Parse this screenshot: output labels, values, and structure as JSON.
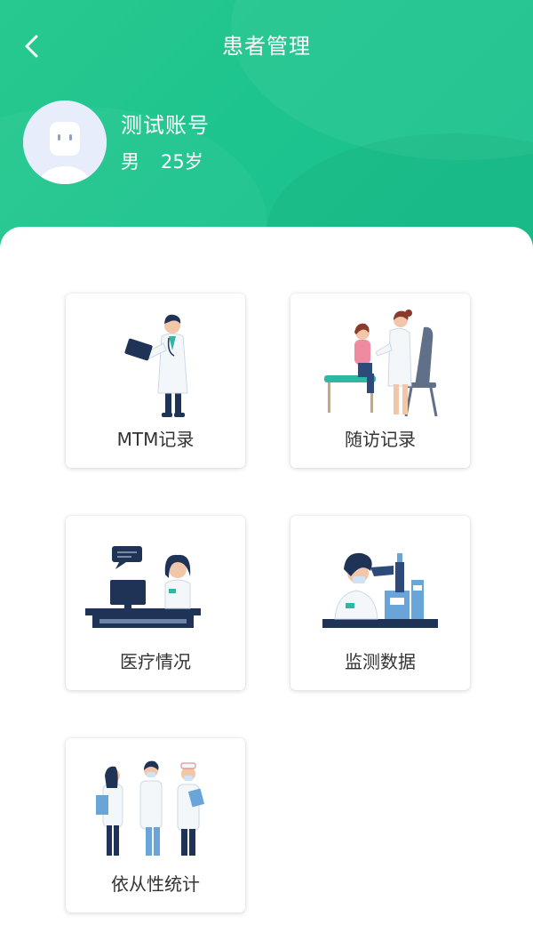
{
  "header": {
    "title": "患者管理",
    "back_icon": "chevron-left-icon"
  },
  "patient": {
    "name": "测试账号",
    "gender": "男",
    "age": "25岁",
    "avatar_icon": "user-avatar-icon"
  },
  "menu": [
    {
      "label": "MTM记录",
      "icon": "doctor-tablet-illustration"
    },
    {
      "label": "随访记录",
      "icon": "doctor-patient-visit-illustration"
    },
    {
      "label": "医疗情况",
      "icon": "doctor-computer-illustration"
    },
    {
      "label": "监测数据",
      "icon": "microscope-lab-illustration"
    },
    {
      "label": "依从性统计",
      "icon": "medical-team-illustration"
    }
  ],
  "colors": {
    "header_green": "#1ec48e",
    "navy": "#1e3356",
    "teal": "#2fb7a6",
    "text": "#333333"
  }
}
